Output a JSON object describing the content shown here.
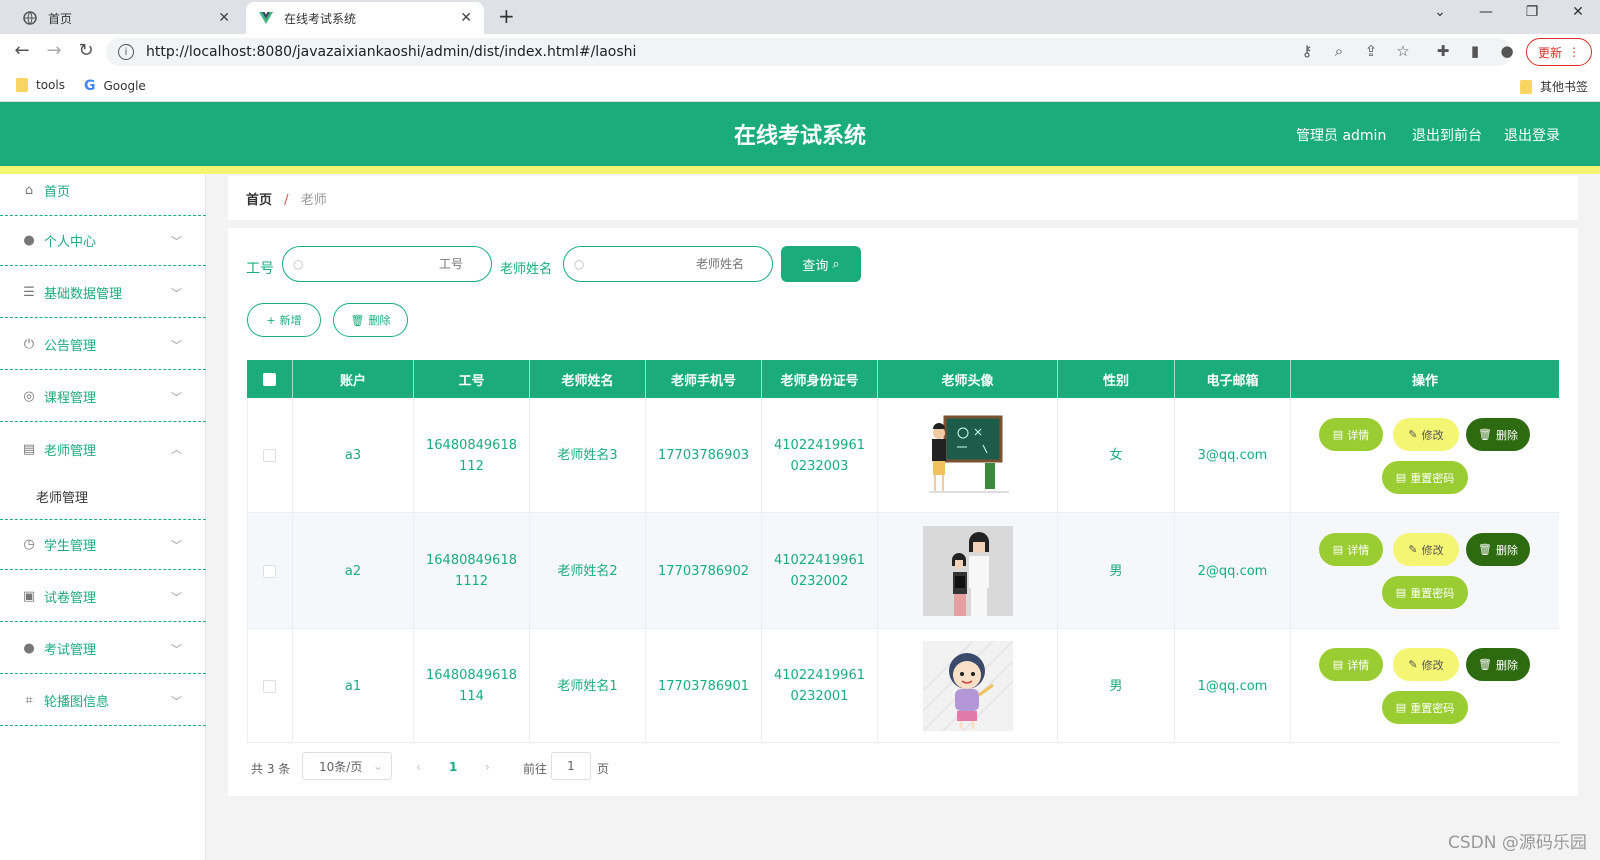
{
  "browser": {
    "tabs": [
      {
        "label": "首页",
        "active": false
      },
      {
        "label": "在线考试系统",
        "active": true
      }
    ],
    "url": "http://localhost:8080/javazaixiankaoshi/admin/dist/index.html#/laoshi",
    "update_label": "更新",
    "bookmarks": [
      "tools",
      "Google"
    ],
    "other_bookmarks": "其他书签"
  },
  "header": {
    "title": "在线考试系统",
    "links": [
      "管理员 admin",
      "退出到前台",
      "退出登录"
    ],
    "accent": "#1aad7b",
    "stripe": "#f5f574"
  },
  "sidebar": {
    "items": [
      {
        "label": "首页",
        "icon": "home-icon"
      },
      {
        "label": "个人中心",
        "icon": "user-icon"
      },
      {
        "label": "基础数据管理",
        "icon": "sliders-icon"
      },
      {
        "label": "公告管理",
        "icon": "power-icon"
      },
      {
        "label": "课程管理",
        "icon": "target-icon"
      },
      {
        "label": "老师管理",
        "icon": "list-icon",
        "expanded": true
      },
      {
        "label": "学生管理",
        "icon": "compass-icon"
      },
      {
        "label": "试卷管理",
        "icon": "clipboard-icon"
      },
      {
        "label": "考试管理",
        "icon": "user-icon"
      },
      {
        "label": "轮播图信息",
        "icon": "crop-icon"
      }
    ],
    "subitem": "老师管理"
  },
  "breadcrumb": {
    "home": "首页",
    "sep": "/",
    "current": "老师"
  },
  "filters": {
    "gonghao_label": "工号",
    "gonghao_placeholder": "工号",
    "name_label": "老师姓名",
    "name_placeholder": "老师姓名",
    "query_button": "查询"
  },
  "actions": {
    "add": "新增",
    "delete": "删除"
  },
  "table": {
    "columns": [
      "账户",
      "工号",
      "老师姓名",
      "老师手机号",
      "老师身份证号",
      "老师头像",
      "性别",
      "电子邮箱",
      "操作"
    ],
    "rows": [
      {
        "account": "a3",
        "gonghao": "16480849618112",
        "name": "老师姓名3",
        "phone": "17703786903",
        "idcard": "410224199610232003",
        "avatar": "teacher-blackboard-image",
        "gender": "女",
        "email": "3@qq.com"
      },
      {
        "account": "a2",
        "gonghao": "164808496181112",
        "name": "老师姓名2",
        "phone": "17703786902",
        "idcard": "410224199610232002",
        "avatar": "teacher-student-photo",
        "gender": "男",
        "email": "2@qq.com"
      },
      {
        "account": "a1",
        "gonghao": "16480849618114",
        "name": "老师姓名1",
        "phone": "17703786901",
        "idcard": "410224199610232001",
        "avatar": "cartoon-teacher-image",
        "gender": "男",
        "email": "1@qq.com"
      }
    ],
    "ops": {
      "detail": "详情",
      "edit": "修改",
      "delete": "删除",
      "reset": "重置密码"
    }
  },
  "pagination": {
    "total": "共 3 条",
    "page_size": "10条/页",
    "current": "1",
    "goto": "前往",
    "goto_value": "1",
    "page_unit": "页"
  },
  "watermark": "CSDN @源码乐园"
}
